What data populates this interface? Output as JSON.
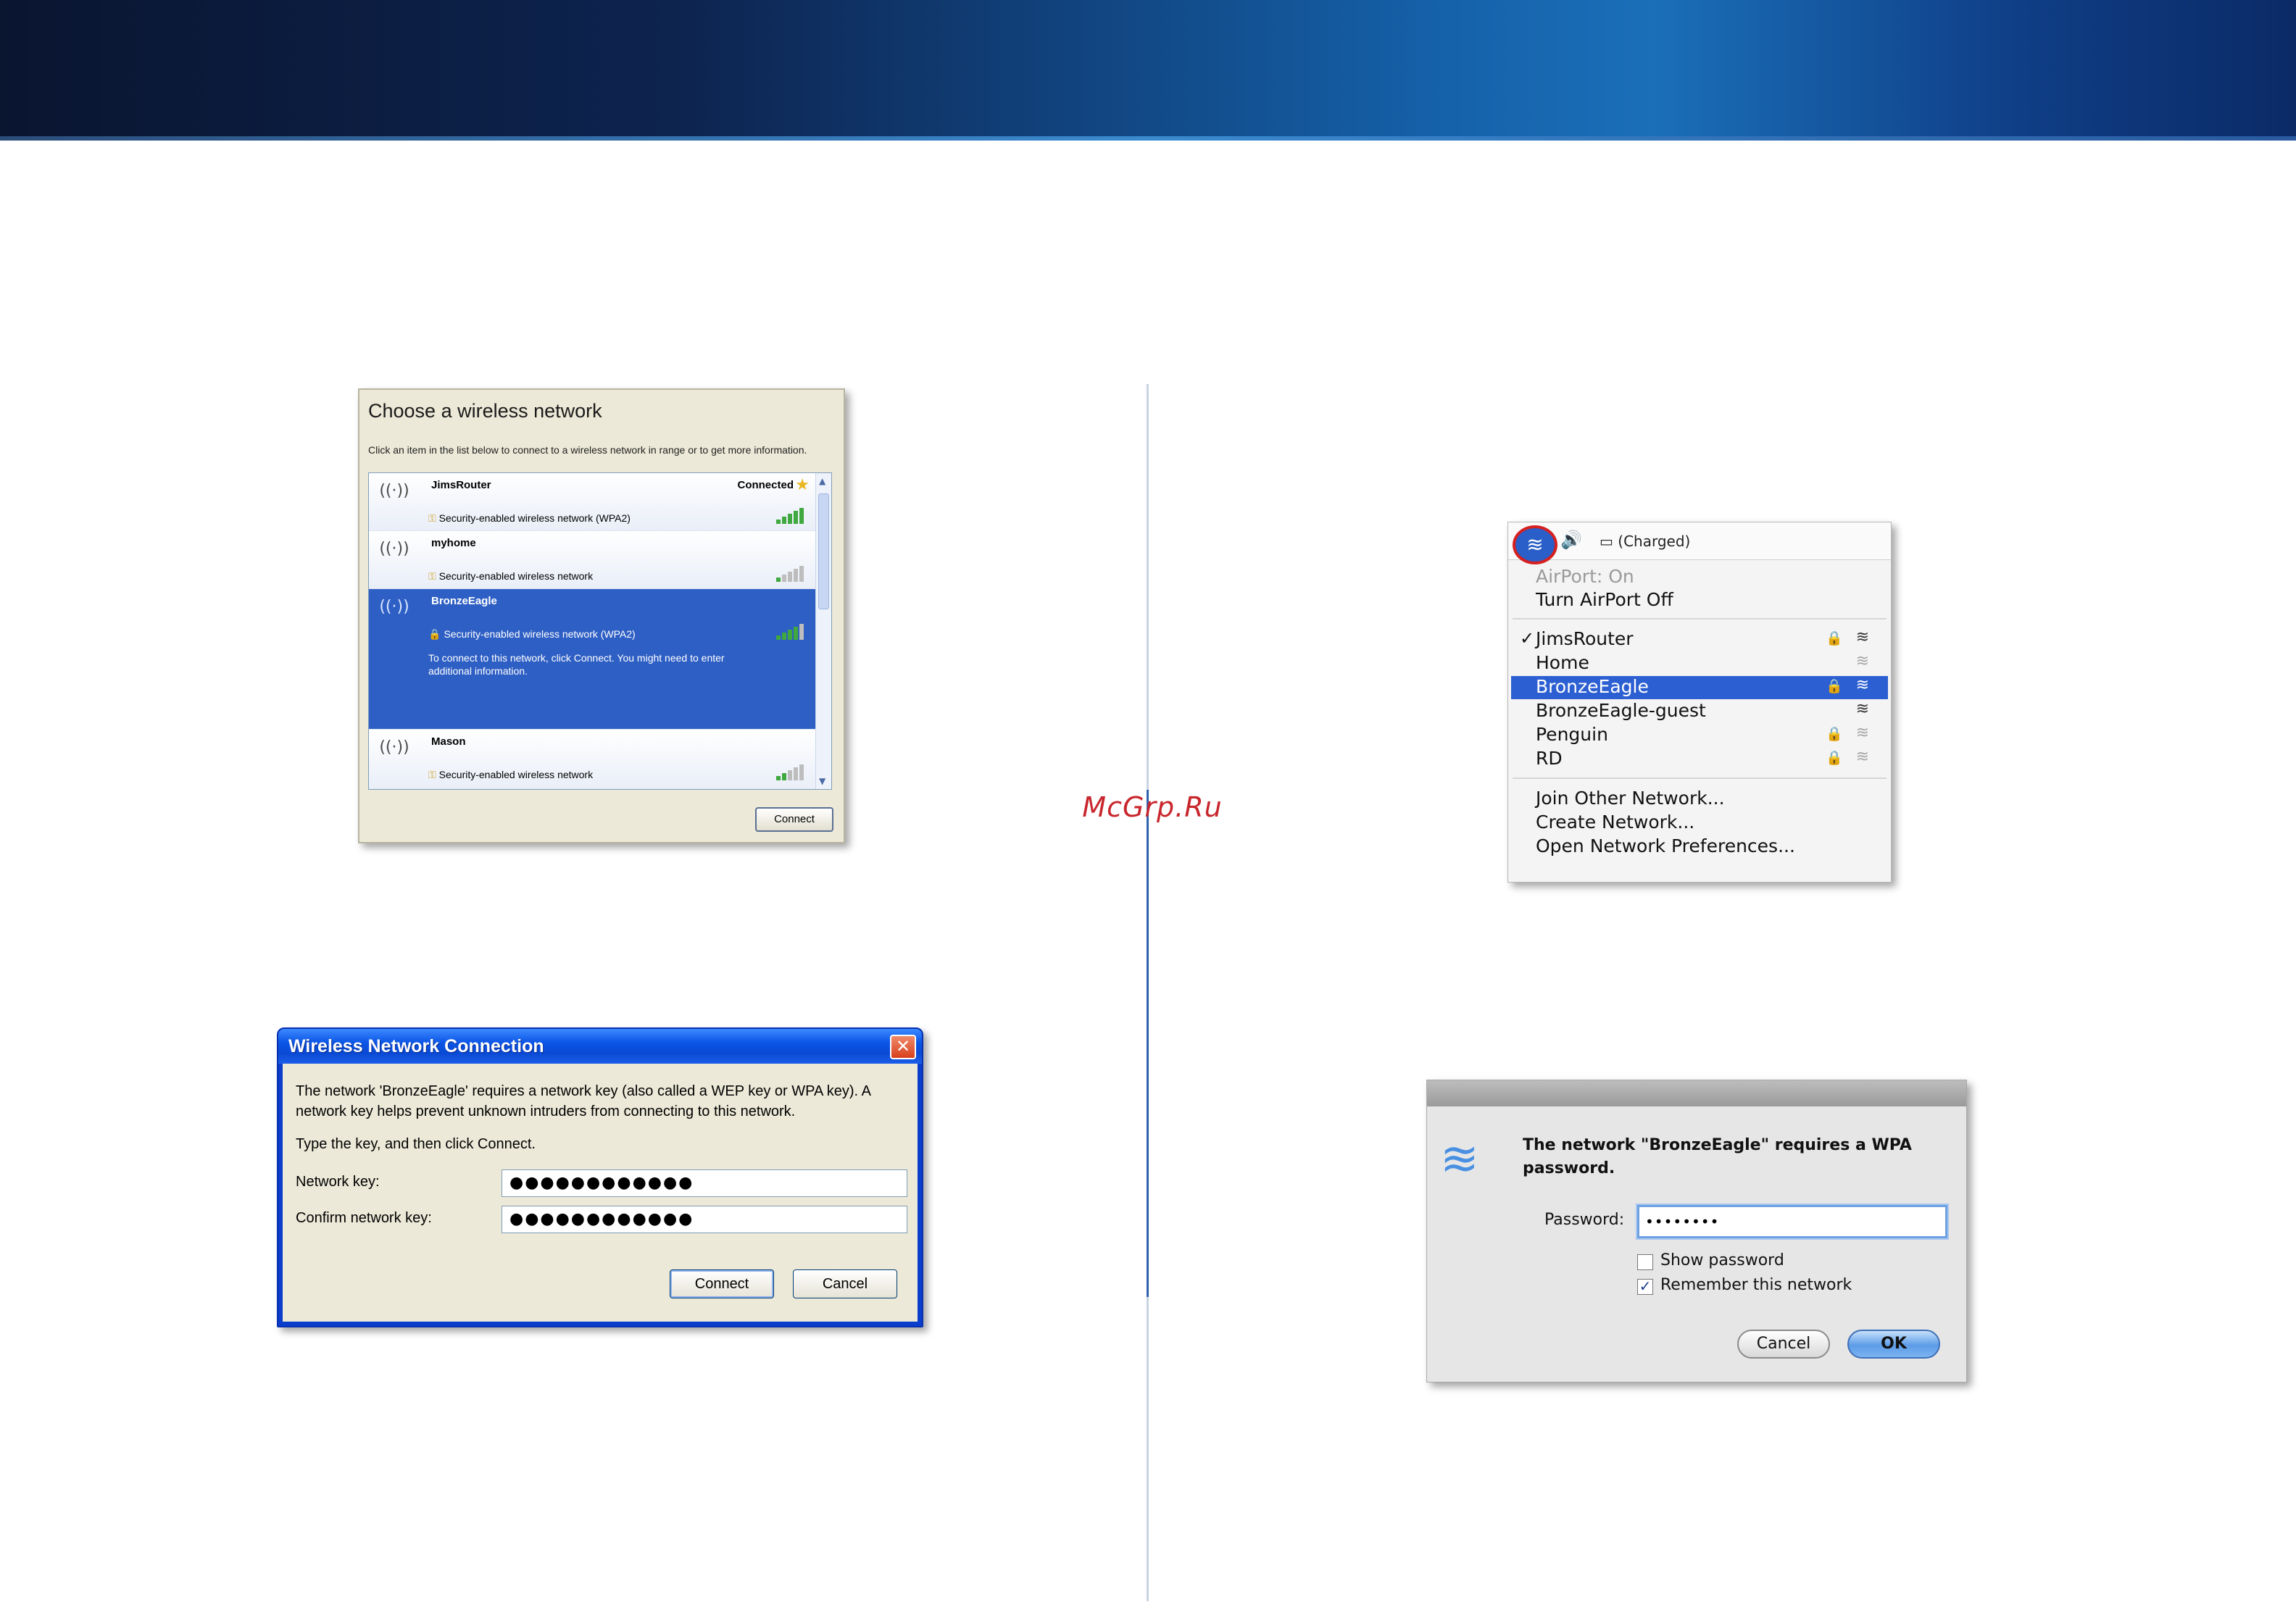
{
  "watermark": "McGrp.Ru",
  "xp_list": {
    "title": "Choose a wireless network",
    "description": "Click an item in the list below to connect to a wireless network in range or to get more information.",
    "networks": [
      {
        "name": "JimsRouter",
        "status": "Connected",
        "security": "Security-enabled wireless network (WPA2)",
        "selected": false
      },
      {
        "name": "myhome",
        "status": "",
        "security": "Security-enabled wireless network",
        "selected": false
      },
      {
        "name": "BronzeEagle",
        "status": "",
        "security": "Security-enabled wireless network (WPA2)",
        "hint": "To connect to this network, click Connect. You might need to enter additional information.",
        "selected": true
      },
      {
        "name": "Mason",
        "status": "",
        "security": "Security-enabled wireless network",
        "selected": false
      }
    ],
    "connect_label": "Connect"
  },
  "xp_dialog": {
    "title": "Wireless Network Connection",
    "message": "The network 'BronzeEagle' requires a network key (also called a WEP key or WPA key). A network key helps prevent unknown intruders from connecting to this network.",
    "instruction": "Type the key, and then click Connect.",
    "network_key_label": "Network key:",
    "confirm_key_label": "Confirm network key:",
    "network_key_value": "●●●●●●●●●●●●",
    "confirm_key_value": "●●●●●●●●●●●●",
    "connect_label": "Connect",
    "cancel_label": "Cancel",
    "close_glyph": "✕"
  },
  "mac_menu": {
    "battery": "(Charged)",
    "airport_status": "AirPort: On",
    "airport_toggle": "Turn AirPort Off",
    "networks": [
      {
        "name": "JimsRouter",
        "checked": true,
        "locked": true,
        "strength": "strong",
        "selected": false
      },
      {
        "name": "Home",
        "checked": false,
        "locked": false,
        "strength": "weak",
        "selected": false
      },
      {
        "name": "BronzeEagle",
        "checked": false,
        "locked": true,
        "strength": "strong",
        "selected": true
      },
      {
        "name": "BronzeEagle-guest",
        "checked": false,
        "locked": false,
        "strength": "strong",
        "selected": false
      },
      {
        "name": "Penguin",
        "checked": false,
        "locked": true,
        "strength": "weak",
        "selected": false
      },
      {
        "name": "RD",
        "checked": false,
        "locked": true,
        "strength": "weak",
        "selected": false
      }
    ],
    "join_other": "Join Other Network...",
    "create_network": "Create Network...",
    "open_prefs": "Open Network Preferences..."
  },
  "mac_dialog": {
    "heading": "The network \"BronzeEagle\" requires a WPA password.",
    "password_label": "Password:",
    "password_value": "••••••••",
    "show_password": "Show password",
    "show_password_checked": false,
    "remember_network": "Remember this network",
    "remember_network_checked": true,
    "cancel_label": "Cancel",
    "ok_label": "OK"
  }
}
